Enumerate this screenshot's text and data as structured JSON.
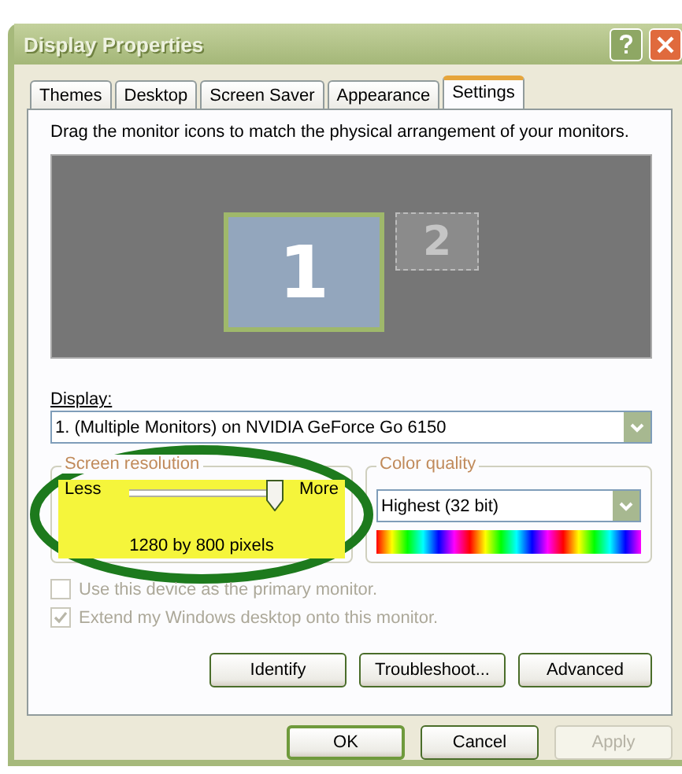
{
  "window": {
    "title": "Display Properties"
  },
  "tabs": [
    {
      "label": "Themes",
      "selected": false
    },
    {
      "label": "Desktop",
      "selected": false
    },
    {
      "label": "Screen Saver",
      "selected": false
    },
    {
      "label": "Appearance",
      "selected": false
    },
    {
      "label": "Settings",
      "selected": true
    }
  ],
  "instruction": "Drag the monitor icons to match the physical arrangement of your monitors.",
  "monitors": [
    {
      "label": "1",
      "selected": true
    },
    {
      "label": "2",
      "selected": false
    }
  ],
  "display": {
    "label": "Display:",
    "value": "1. (Multiple Monitors) on NVIDIA GeForce Go 6150"
  },
  "screen_resolution": {
    "title": "Screen resolution",
    "min_label": "Less",
    "max_label": "More",
    "level": 1,
    "reading": "1280 by 800 pixels"
  },
  "color_quality": {
    "title": "Color quality",
    "value": "Highest (32 bit)"
  },
  "checkboxes": [
    {
      "label": "Use this device as the primary monitor.",
      "checked": false,
      "disabled": true
    },
    {
      "label": "Extend my Windows desktop onto this monitor.",
      "checked": true,
      "disabled": true
    }
  ],
  "buttons": [
    {
      "label": "Identify",
      "disabled": false
    },
    {
      "label": "Troubleshoot...",
      "disabled": false
    },
    {
      "label": "Advanced",
      "disabled": false
    }
  ],
  "dialog_buttons": [
    {
      "label": "OK",
      "disabled": false,
      "default": true
    },
    {
      "label": "Cancel",
      "disabled": false,
      "default": false
    },
    {
      "label": "Apply",
      "disabled": true,
      "default": false
    }
  ]
}
